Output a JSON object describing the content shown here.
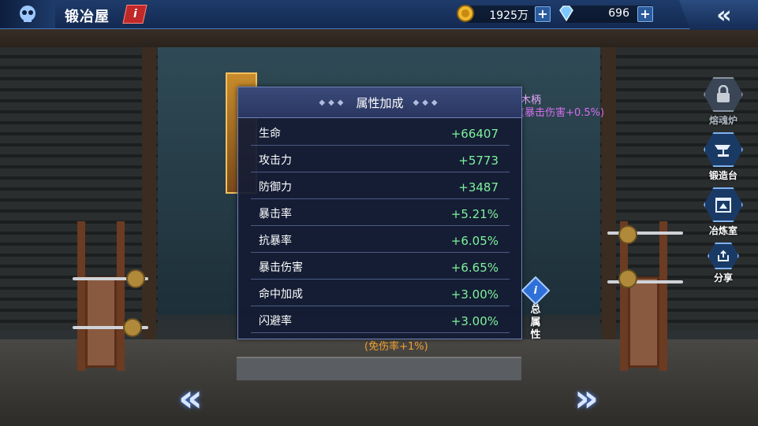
{
  "header": {
    "title": "锻冶屋",
    "info_icon": "i"
  },
  "resources": [
    {
      "name": "gold",
      "icon": "coin-icon",
      "value": "1925万"
    },
    {
      "name": "diamond",
      "icon": "diamond-icon",
      "value": "696"
    }
  ],
  "side_menu": [
    {
      "label": "熔魂炉",
      "icon": "lock-icon",
      "locked": true
    },
    {
      "label": "锻造台",
      "icon": "anvil-icon",
      "locked": false
    },
    {
      "label": "冶炼室",
      "icon": "furnace-icon",
      "locked": false
    },
    {
      "label": "分享",
      "icon": "share-icon",
      "locked": false
    }
  ],
  "attribute_panel": {
    "title": "属性加成",
    "rows": [
      {
        "name": "生命",
        "value": "+66407"
      },
      {
        "name": "攻击力",
        "value": "+5773"
      },
      {
        "name": "防御力",
        "value": "+3487"
      },
      {
        "name": "暴击率",
        "value": "+5.21%"
      },
      {
        "name": "抗暴率",
        "value": "+6.05%"
      },
      {
        "name": "暴击伤害",
        "value": "+6.65%"
      },
      {
        "name": "命中加成",
        "value": "+3.00%"
      },
      {
        "name": "闪避率",
        "value": "+3.00%"
      }
    ]
  },
  "partial_texts": {
    "right_top_1": "木柄",
    "right_top_2": "(暴击伤害+0.5%)",
    "bonus": "(免伤率+1%)"
  },
  "total_attr_button": {
    "label": "总属性"
  },
  "colors": {
    "positive_value": "#7ef29a",
    "bonus_text": "#f0a030",
    "accent_blue": "#2a5b9c"
  }
}
